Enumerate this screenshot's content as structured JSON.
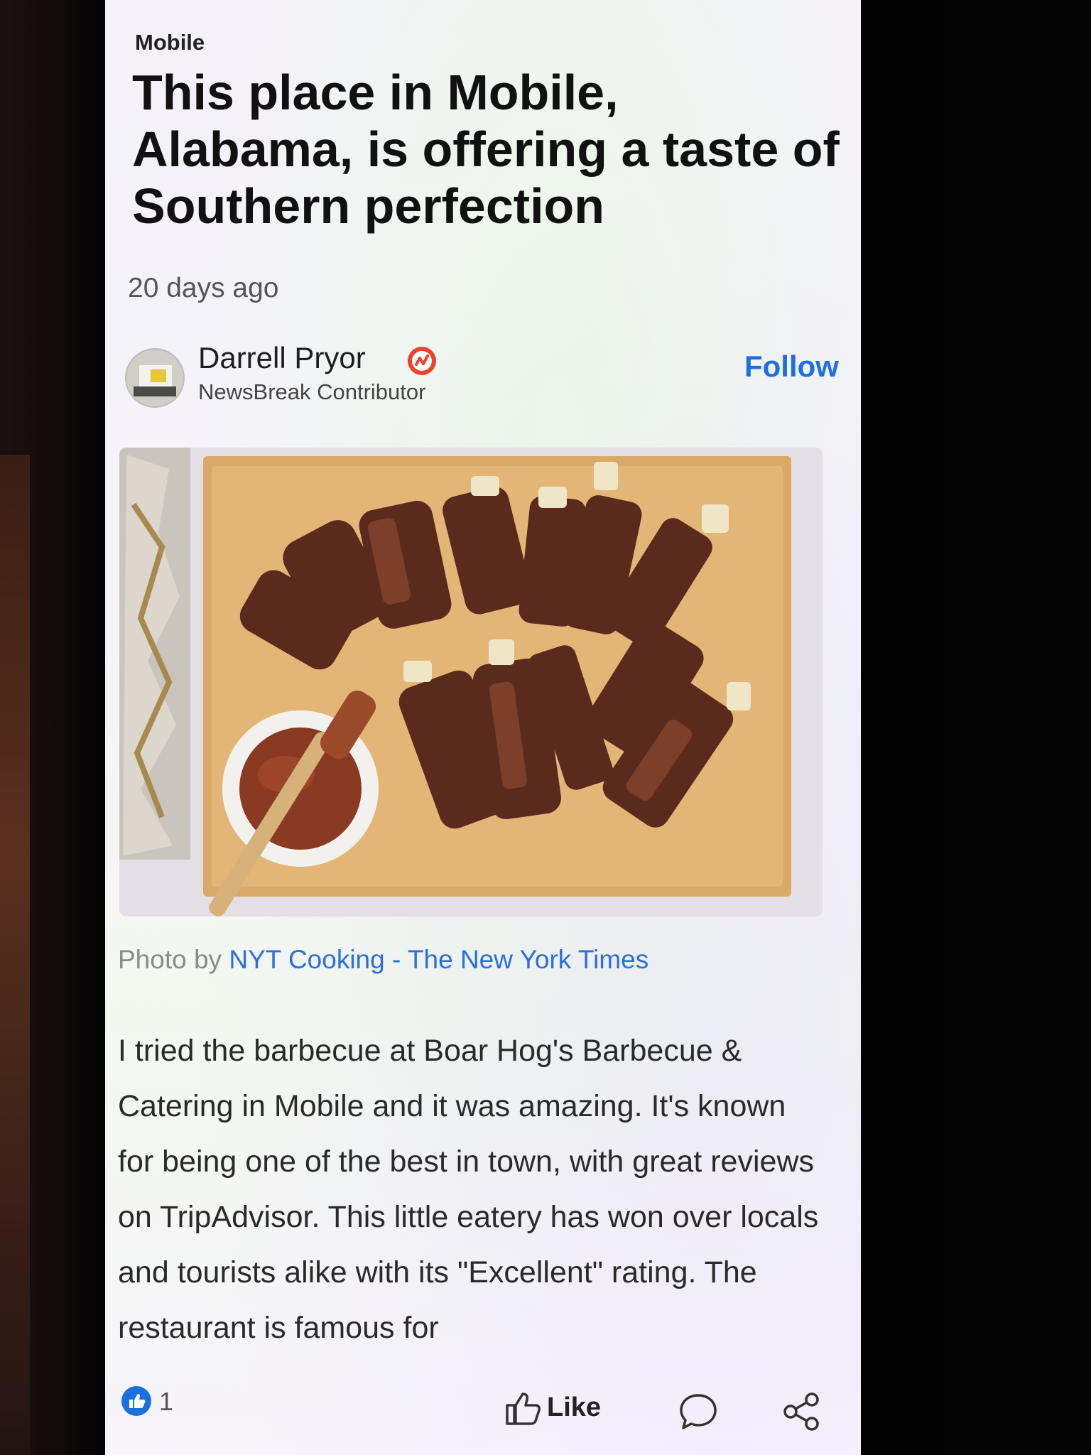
{
  "article": {
    "category": "Mobile",
    "headline": "This place in Mobile, Alabama, is offering a taste of Southern perfection",
    "timestamp": "20 days ago",
    "author": {
      "name": "Darrell Pryor",
      "role": "NewsBreak Contributor",
      "follow_label": "Follow"
    },
    "photo_credit": {
      "prefix": "Photo by",
      "source": "NYT Cooking - The New York Times"
    },
    "body": "I tried the barbecue at Boar Hog's Barbecue & Catering in Mobile and it was amazing. It's known for being one of the best in town, with great reviews on TripAdvisor. This little eatery has won over locals and tourists alike with its \"Excellent\" rating. The restaurant is famous for"
  },
  "actions": {
    "like_count": "1",
    "like_label": "Like"
  },
  "colors": {
    "link": "#1d6fe0",
    "verified": "#e8442f"
  }
}
